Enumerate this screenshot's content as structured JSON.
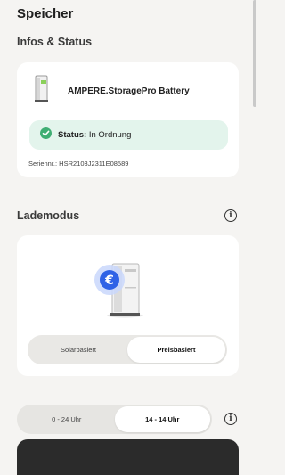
{
  "header": {
    "title": "Speicher"
  },
  "info_section": {
    "title": "Infos & Status",
    "device_name": "AMPERE.StoragePro Battery",
    "status_label": "Status:",
    "status_value": "In Ordnung",
    "serial": "Seriennr.: HSR2103J2311E08589"
  },
  "charge_mode": {
    "title": "Lademodus",
    "options": [
      "Solarbasiert",
      "Preisbasiert"
    ],
    "selected": "Preisbasiert"
  },
  "time_range": {
    "options": [
      "0 - 24 Uhr",
      "14 - 14 Uhr"
    ],
    "selected": "14 - 14 Uhr"
  },
  "colors": {
    "status_green": "#3fae73",
    "euro_blue": "#2f62e6",
    "bottom_sheet": "#2b2b2b"
  },
  "icons": [
    "battery-device-icon",
    "check-circle-icon",
    "info-icon",
    "euro-icon"
  ]
}
